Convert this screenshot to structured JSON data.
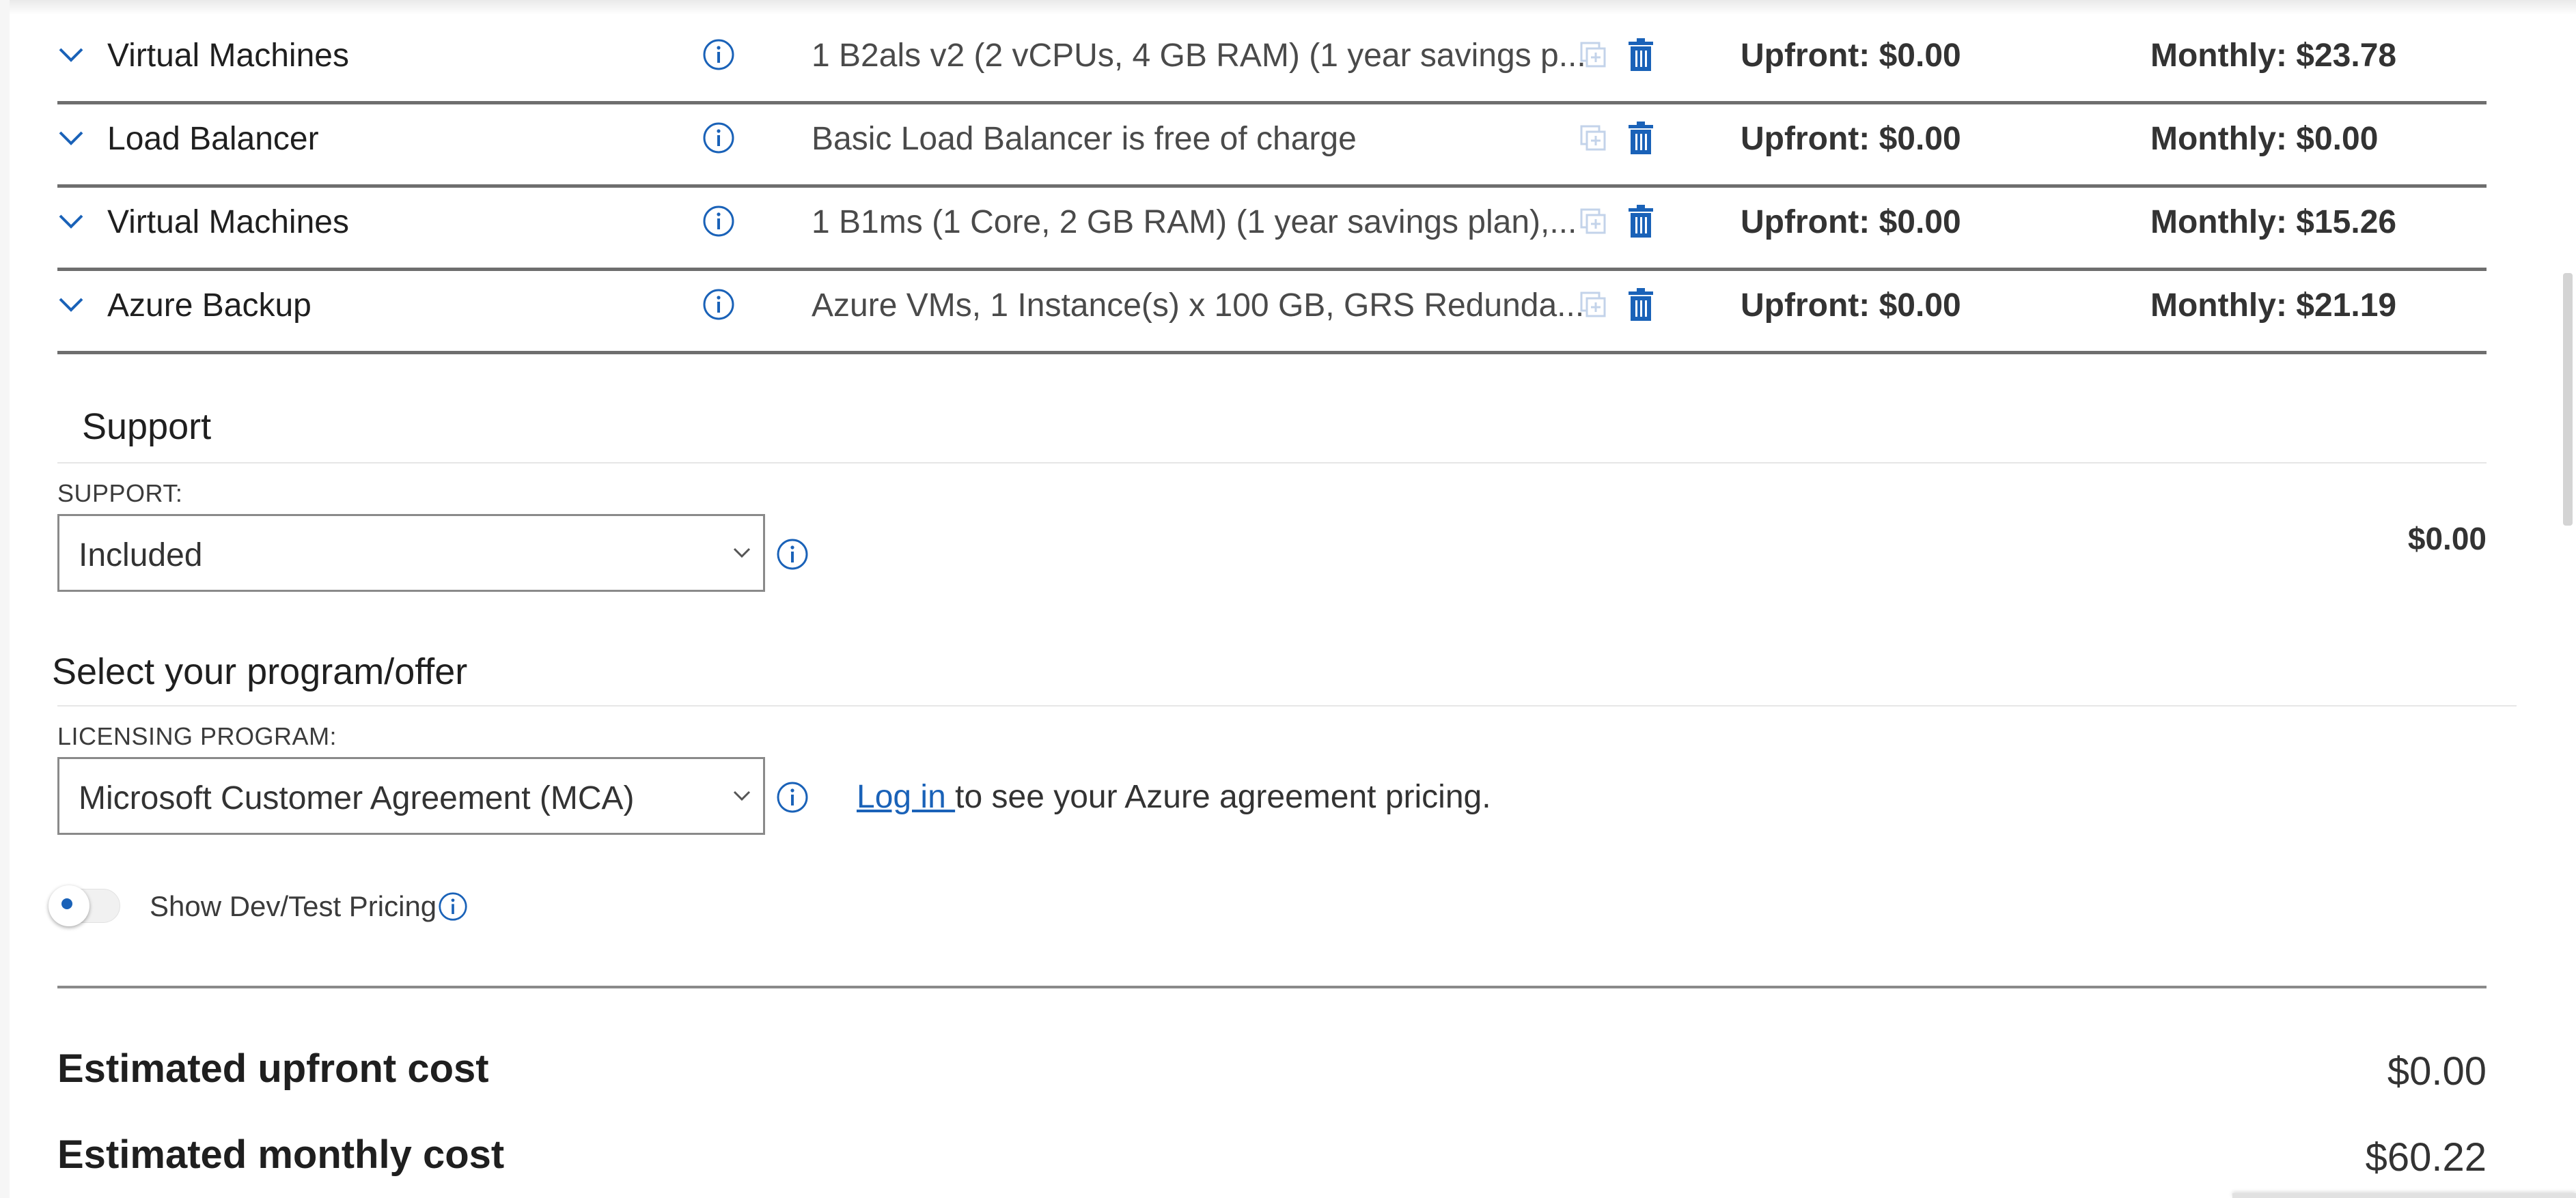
{
  "estimate_rows": [
    {
      "name": "Virtual Machines",
      "description": "1 B2als v2 (2 vCPUs, 4 GB RAM) (1 year savings p...",
      "upfront": "Upfront: $0.00",
      "monthly": "Monthly: $23.78"
    },
    {
      "name": "Load Balancer",
      "description": "Basic Load Balancer is free of charge",
      "upfront": "Upfront: $0.00",
      "monthly": "Monthly: $0.00"
    },
    {
      "name": "Virtual Machines",
      "description": "1 B1ms (1 Core, 2 GB RAM) (1 year savings plan),...",
      "upfront": "Upfront: $0.00",
      "monthly": "Monthly: $15.26"
    },
    {
      "name": "Azure Backup",
      "description": "Azure VMs, 1 Instance(s) x 100 GB, GRS Redunda...",
      "upfront": "Upfront: $0.00",
      "monthly": "Monthly: $21.19"
    }
  ],
  "support": {
    "title": "Support",
    "label": "SUPPORT:",
    "selected": "Included",
    "price": "$0.00"
  },
  "program": {
    "title": "Select your program/offer",
    "label": "LICENSING PROGRAM:",
    "selected": "Microsoft Customer Agreement (MCA)",
    "login_link": "Log in ",
    "login_text": "to see your Azure agreement pricing."
  },
  "devtest": {
    "label": "Show Dev/Test Pricing",
    "enabled": false
  },
  "totals": {
    "upfront_label": "Estimated upfront cost",
    "upfront_value": "$0.00",
    "monthly_label": "Estimated monthly cost",
    "monthly_value": "$60.22"
  },
  "colors": {
    "accent": "#1a62b8",
    "row_divider": "#6e6e6e"
  },
  "icons": {
    "expand": "chevron-down-icon",
    "info": "info-icon",
    "clone": "copy-icon",
    "delete": "trash-icon",
    "dropdown": "chevron-down-icon"
  }
}
